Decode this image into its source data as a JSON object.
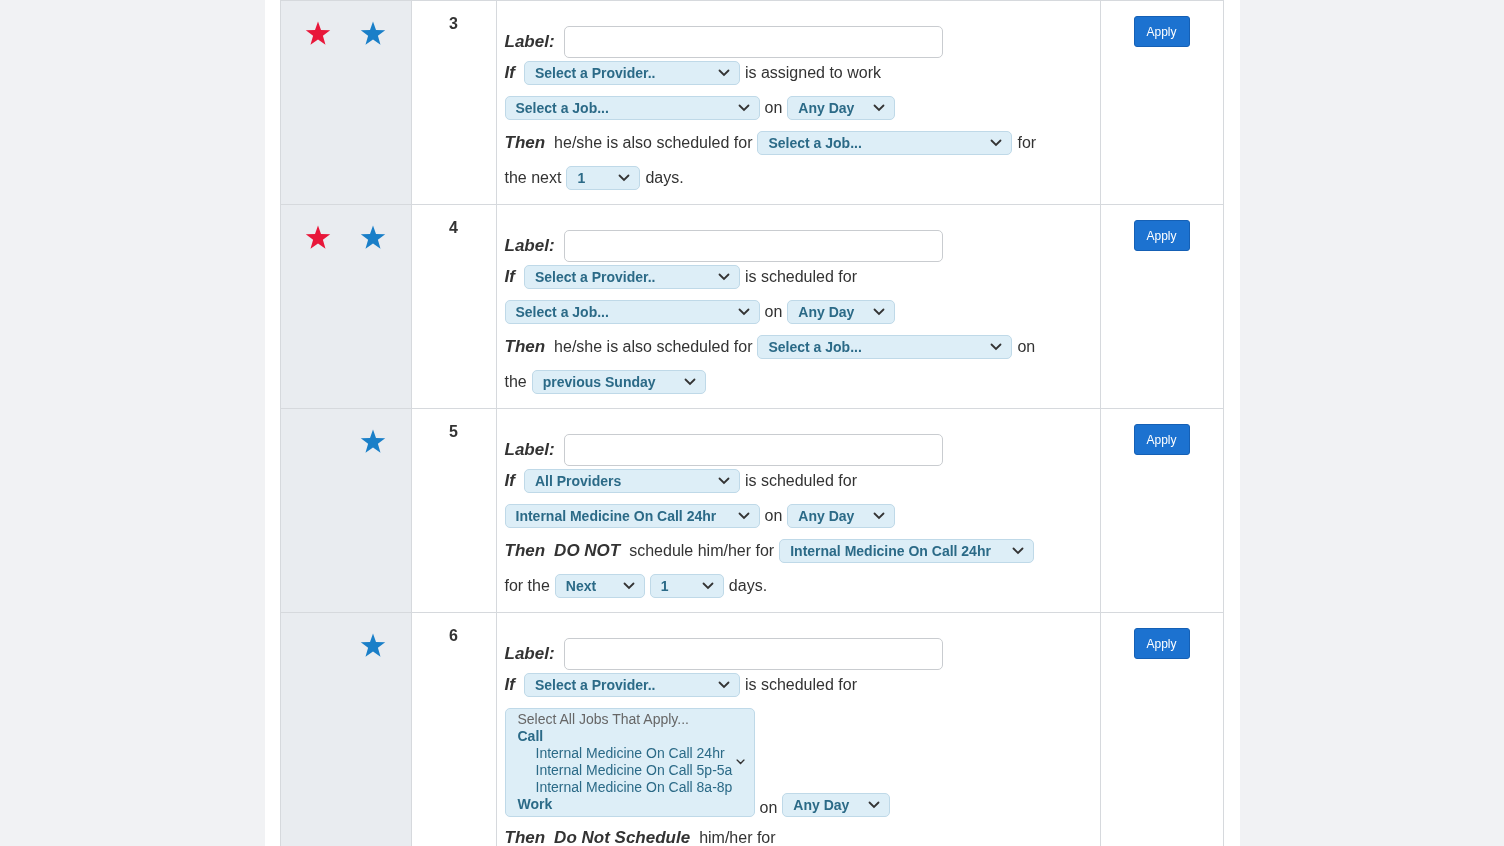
{
  "rules": [
    {
      "number": "3",
      "flagged": true,
      "starred": true,
      "button": "Apply",
      "lines": [
        [
          {
            "kind": "keyword",
            "text": "Label:"
          },
          {
            "kind": "input"
          }
        ],
        [
          {
            "kind": "keyword",
            "text": "If"
          },
          {
            "kind": "provider_select",
            "value": "Select a Provider.."
          },
          {
            "kind": "text",
            "text": "is assigned to work"
          }
        ],
        [
          {
            "kind": "job_select",
            "value": "Select a Job..."
          },
          {
            "kind": "text",
            "text": "on"
          },
          {
            "kind": "day_select",
            "value": "Any Day"
          }
        ],
        [
          {
            "kind": "keyword",
            "text": "Then"
          },
          {
            "kind": "text",
            "text": "he/she is also scheduled for"
          },
          {
            "kind": "job_select",
            "value": "Select a Job..."
          },
          {
            "kind": "text",
            "text": "for"
          }
        ],
        [
          {
            "kind": "text",
            "text": "the next"
          },
          {
            "kind": "count_select",
            "value": "1"
          },
          {
            "kind": "text",
            "text": "days."
          }
        ]
      ]
    },
    {
      "number": "4",
      "flagged": true,
      "starred": true,
      "button": "Apply",
      "lines": [
        [
          {
            "kind": "keyword",
            "text": "Label:"
          },
          {
            "kind": "input"
          }
        ],
        [
          {
            "kind": "keyword",
            "text": "If"
          },
          {
            "kind": "provider_select",
            "value": "Select a Provider.."
          },
          {
            "kind": "text",
            "text": "is scheduled for"
          }
        ],
        [
          {
            "kind": "job_select",
            "value": "Select a Job..."
          },
          {
            "kind": "text",
            "text": "on"
          },
          {
            "kind": "day_select",
            "value": "Any Day"
          }
        ],
        [
          {
            "kind": "keyword",
            "text": "Then"
          },
          {
            "kind": "text",
            "text": "he/she is also scheduled for"
          },
          {
            "kind": "job_select",
            "value": "Select a Job..."
          },
          {
            "kind": "text",
            "text": "on"
          }
        ],
        [
          {
            "kind": "text",
            "text": "the"
          },
          {
            "kind": "weekday_select",
            "value": "previous Sunday"
          }
        ]
      ]
    },
    {
      "number": "5",
      "flagged": false,
      "starred": true,
      "button": "Apply",
      "lines": [
        [
          {
            "kind": "keyword",
            "text": "Label:"
          },
          {
            "kind": "input"
          }
        ],
        [
          {
            "kind": "keyword",
            "text": "If"
          },
          {
            "kind": "provider_select",
            "value": "All Providers"
          },
          {
            "kind": "text",
            "text": "is scheduled for"
          }
        ],
        [
          {
            "kind": "job_select",
            "value": "Internal Medicine On Call 24hr"
          },
          {
            "kind": "text",
            "text": "on"
          },
          {
            "kind": "day_select",
            "value": "Any Day"
          }
        ],
        [
          {
            "kind": "keyword",
            "text": "Then"
          },
          {
            "kind": "keyword",
            "text": "DO NOT"
          },
          {
            "kind": "text",
            "text": "schedule him/her for"
          },
          {
            "kind": "job_select",
            "value": "Internal Medicine On Call 24hr"
          }
        ],
        [
          {
            "kind": "text",
            "text": "for the"
          },
          {
            "kind": "direction_select",
            "value": "Next"
          },
          {
            "kind": "count_select",
            "value": "1"
          },
          {
            "kind": "text",
            "text": "days."
          }
        ]
      ]
    },
    {
      "number": "6",
      "flagged": false,
      "starred": true,
      "button": "Apply",
      "lines": [
        [
          {
            "kind": "keyword",
            "text": "Label:"
          },
          {
            "kind": "input"
          }
        ],
        [
          {
            "kind": "keyword",
            "text": "If"
          },
          {
            "kind": "provider_select",
            "value": "Select a Provider.."
          },
          {
            "kind": "text",
            "text": "is scheduled for"
          }
        ],
        [
          {
            "kind": "multiselect",
            "placeholder": "Select All Jobs That Apply...",
            "groups": [
              {
                "label": "Call",
                "options": [
                  {
                    "label": "Internal Medicine On Call 24hr",
                    "selected": false
                  },
                  {
                    "label": "Internal Medicine On Call 5p-5a",
                    "selected": false
                  },
                  {
                    "label": "Internal Medicine On Call 8a-8p",
                    "selected": false
                  }
                ]
              },
              {
                "label": "Work"
              }
            ]
          },
          {
            "kind": "text",
            "text": "on"
          },
          {
            "kind": "day_select",
            "value": "Any Day"
          }
        ],
        [
          {
            "kind": "keyword",
            "text": "Then"
          },
          {
            "kind": "keyword",
            "text": "Do Not Schedule"
          },
          {
            "kind": "text",
            "text": "him/her for"
          }
        ]
      ]
    }
  ]
}
